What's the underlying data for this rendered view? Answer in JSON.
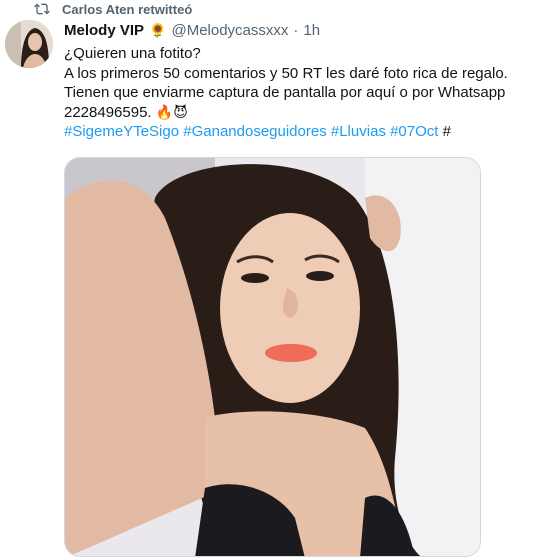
{
  "retweet": {
    "label": "Carlos Aten retwitteó",
    "icon": "retweet-icon"
  },
  "tweet": {
    "author_name": "Melody VIP",
    "author_emoji": "🌻",
    "handle": "@Melodycassxxx",
    "separator": "·",
    "time": "1h",
    "lines": [
      "¿Quieren una fotito?",
      "A los primeros 50 comentarios y 50 RT les daré foto rica de regalo.",
      "Tienen que enviarme captura de pantalla por aquí o por Whatsapp",
      "2228496595."
    ],
    "line4_emoji": "🔥😈",
    "hashtags": [
      "#SigemeYTeSigo",
      "#Ganandoseguidores",
      "#Lluvias",
      "#07Oct"
    ],
    "trailing": "#"
  },
  "colors": {
    "link": "#1d9bf0",
    "secondary": "#536471",
    "text": "#0f1419"
  }
}
